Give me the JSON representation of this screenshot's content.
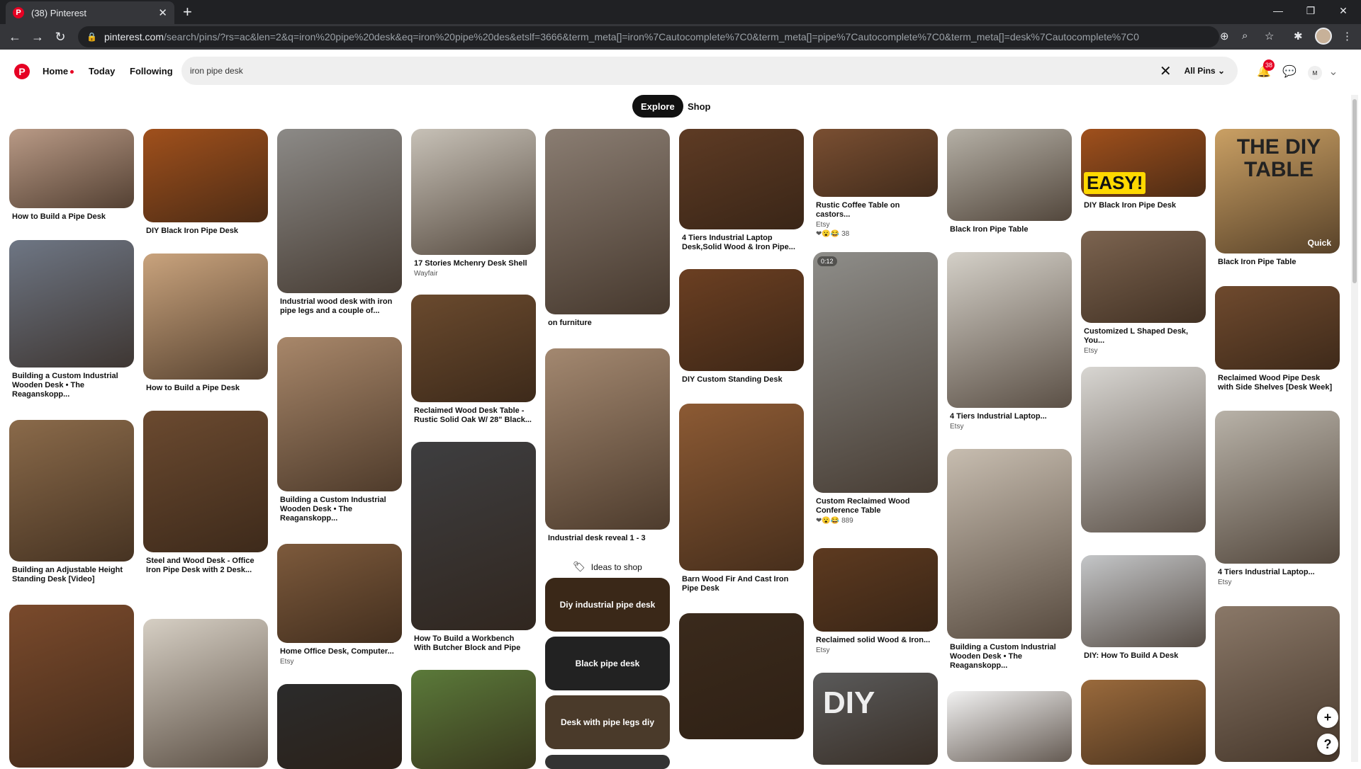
{
  "browser": {
    "tab_title": "(38) Pinterest",
    "tab_favicon": "P",
    "url_host": "pinterest.com",
    "url_rest": "/search/pins/?rs=ac&len=2&q=iron%20pipe%20desk&eq=iron%20pipe%20des&etslf=3666&term_meta[]=iron%7Cautocomplete%7C0&term_meta[]=pipe%7Cautocomplete%7C0&term_meta[]=desk%7Cautocomplete%7C0"
  },
  "header": {
    "logo": "P",
    "nav_home": "Home",
    "nav_today": "Today",
    "nav_following": "Following",
    "search_value": "iron pipe desk",
    "scope": "All Pins",
    "notifications_count": "38",
    "avatar_letter": "M"
  },
  "tabs": {
    "explore": "Explore",
    "shop": "Shop"
  },
  "pins": [
    {
      "title": "How to Build a Pipe Desk",
      "sub": "",
      "color": "#b99a86"
    },
    {
      "title": "Building a Custom Industrial Wooden Desk • The Reaganskopp...",
      "sub": "",
      "color": "#6e7684"
    },
    {
      "title": "Building an Adjustable Height Standing Desk [Video]",
      "sub": "",
      "color": "#8a6a4a"
    },
    {
      "title": "",
      "sub": "",
      "color": "#7a4a2c"
    },
    {
      "title": "DIY Black Iron Pipe Desk",
      "sub": "",
      "color": "#a0501c"
    },
    {
      "title": "How to Build a Pipe Desk",
      "sub": "",
      "color": "#c9a37d"
    },
    {
      "title": "Steel and Wood Desk - Office Iron Pipe Desk with 2 Desk...",
      "sub": "",
      "color": "#6b4a30"
    },
    {
      "title": "",
      "sub": "",
      "color": "#d6cfc4"
    },
    {
      "title": "Industrial wood desk with iron pipe legs and a couple of...",
      "sub": "",
      "color": "#8c8a87"
    },
    {
      "title": "Building a Custom Industrial Wooden Desk • The Reaganskopp...",
      "sub": "",
      "color": "#a8876a"
    },
    {
      "title": "Home Office Desk, Computer...",
      "sub": "Etsy",
      "color": "#7d5a3c"
    },
    {
      "title": "",
      "sub": "",
      "color": "#2b2b2b"
    },
    {
      "title": "17 Stories Mchenry Desk Shell",
      "sub": "Wayfair",
      "color": "#c7c1b7"
    },
    {
      "title": "Reclaimed Wood Desk Table - Rustic Solid Oak W/ 28\" Black...",
      "sub": "",
      "color": "#6a4a2e"
    },
    {
      "title": "How To Build a Workbench With Butcher Block and Pipe",
      "sub": "",
      "color": "#3e3e40"
    },
    {
      "title": "",
      "sub": "",
      "color": "#5b7a3a"
    },
    {
      "title": "on furniture",
      "sub": "",
      "color": "#8a7d72"
    },
    {
      "title": "Industrial desk reveal 1 - 3",
      "sub": "",
      "color": "#a38870"
    },
    {
      "title": "4 Tiers Industrial Laptop Desk,Solid Wood & Iron Pipe...",
      "sub": "",
      "color": "#5e3b24"
    },
    {
      "title": "DIY Custom Standing Desk",
      "sub": "",
      "color": "#6b3f22"
    },
    {
      "title": "Barn Wood Fir And Cast Iron Pipe Desk",
      "sub": "",
      "color": "#8c5a34"
    },
    {
      "title": "",
      "sub": "",
      "color": "#3a2a1c"
    },
    {
      "title": "Rustic Coffee Table on castors...",
      "sub": "Etsy",
      "color": "#7a4f32"
    },
    {
      "title": "Custom Reclaimed Wood Conference Table",
      "sub": "",
      "color": "#8e8d89"
    },
    {
      "title": "Reclaimed solid Wood & Iron...",
      "sub": "Etsy",
      "color": "#5d3a20"
    },
    {
      "title": "",
      "sub": "",
      "color": "#5a5a5a"
    },
    {
      "title": "Black Iron Pipe Table",
      "sub": "",
      "color": "#b5b0a6"
    },
    {
      "title": "4 Tiers Industrial Laptop...",
      "sub": "Etsy",
      "color": "#d4d0c8"
    },
    {
      "title": "Building a Custom Industrial Wooden Desk • The Reaganskopp...",
      "sub": "",
      "color": "#c7bdb0"
    },
    {
      "title": "",
      "sub": "",
      "color": "#f2f2f2"
    },
    {
      "title": "DIY Black Iron Pipe Desk",
      "sub": "",
      "color": "#a0501c"
    },
    {
      "title": "Customized L Shaped Desk, You...",
      "sub": "Etsy",
      "color": "#7c6450"
    },
    {
      "title": "",
      "sub": "",
      "color": "#d8d6d2"
    },
    {
      "title": "DIY: How To Build A Desk",
      "sub": "",
      "color": "#c4c6c8"
    },
    {
      "title": "",
      "sub": "",
      "color": "#9a6a3c"
    },
    {
      "title": "Black Iron Pipe Table",
      "sub": "",
      "color": "#caa064"
    },
    {
      "title": "Reclaimed Wood Pipe Desk with Side Shelves [Desk Week]",
      "sub": "",
      "color": "#6f4a2e"
    },
    {
      "title": "4 Tiers Industrial Laptop...",
      "sub": "Etsy",
      "color": "#b8b2a8"
    },
    {
      "title": "",
      "sub": "",
      "color": "#8a7868"
    }
  ],
  "reactions": {
    "rustic": "38",
    "conference": "889"
  },
  "ideas": {
    "label": "Ideas to shop",
    "items": [
      "Diy industrial pipe desk",
      "Black pipe desk",
      "Desk with pipe legs diy"
    ]
  },
  "overlays": {
    "easy": "EASY!",
    "diy_table": "THE DIY TABLE",
    "quick": "Quick",
    "video_time": "0:12",
    "diy": "DIY"
  },
  "fab": {
    "plus": "+",
    "help": "?"
  }
}
